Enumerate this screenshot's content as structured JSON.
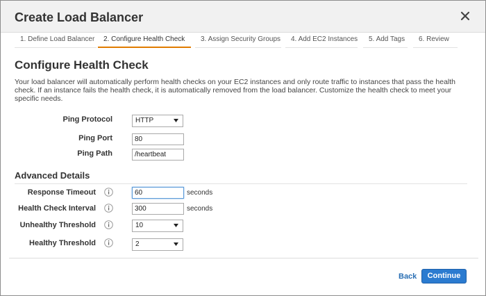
{
  "dialog": {
    "title": "Create Load Balancer"
  },
  "steps": [
    {
      "label": "1. Define Load Balancer"
    },
    {
      "label": "2. Configure Health Check"
    },
    {
      "label": "3. Assign Security Groups"
    },
    {
      "label": "4. Add EC2 Instances"
    },
    {
      "label": "5. Add Tags"
    },
    {
      "label": "6. Review"
    }
  ],
  "active_step": "2. Configure Health Check",
  "section": {
    "title": "Configure Health Check",
    "description": "Your load balancer will automatically perform health checks on your EC2 instances and only route traffic to instances that pass the health check. If an instance fails the health check, it is automatically removed from the load balancer. Customize the health check to meet your specific needs."
  },
  "fields": {
    "ping_protocol": {
      "label": "Ping Protocol",
      "value": "HTTP"
    },
    "ping_port": {
      "label": "Ping Port",
      "value": "80"
    },
    "ping_path": {
      "label": "Ping Path",
      "value": "/heartbeat"
    }
  },
  "advanced": {
    "title": "Advanced Details",
    "response_timeout": {
      "label": "Response Timeout",
      "value": "60",
      "unit": "seconds"
    },
    "health_check_interval": {
      "label": "Health Check Interval",
      "value": "300",
      "unit": "seconds"
    },
    "unhealthy_threshold": {
      "label": "Unhealthy Threshold",
      "value": "10"
    },
    "healthy_threshold": {
      "label": "Healthy Threshold",
      "value": "2"
    }
  },
  "footer": {
    "back_label": "Back",
    "continue_label": "Continue"
  },
  "icons": {
    "close": "close-icon",
    "info": "info-icon",
    "dropdown": "chevron-down-icon"
  },
  "colors": {
    "accent": "#e07b00",
    "primary_button": "#2b7bd0",
    "link": "#2a6fb4"
  }
}
